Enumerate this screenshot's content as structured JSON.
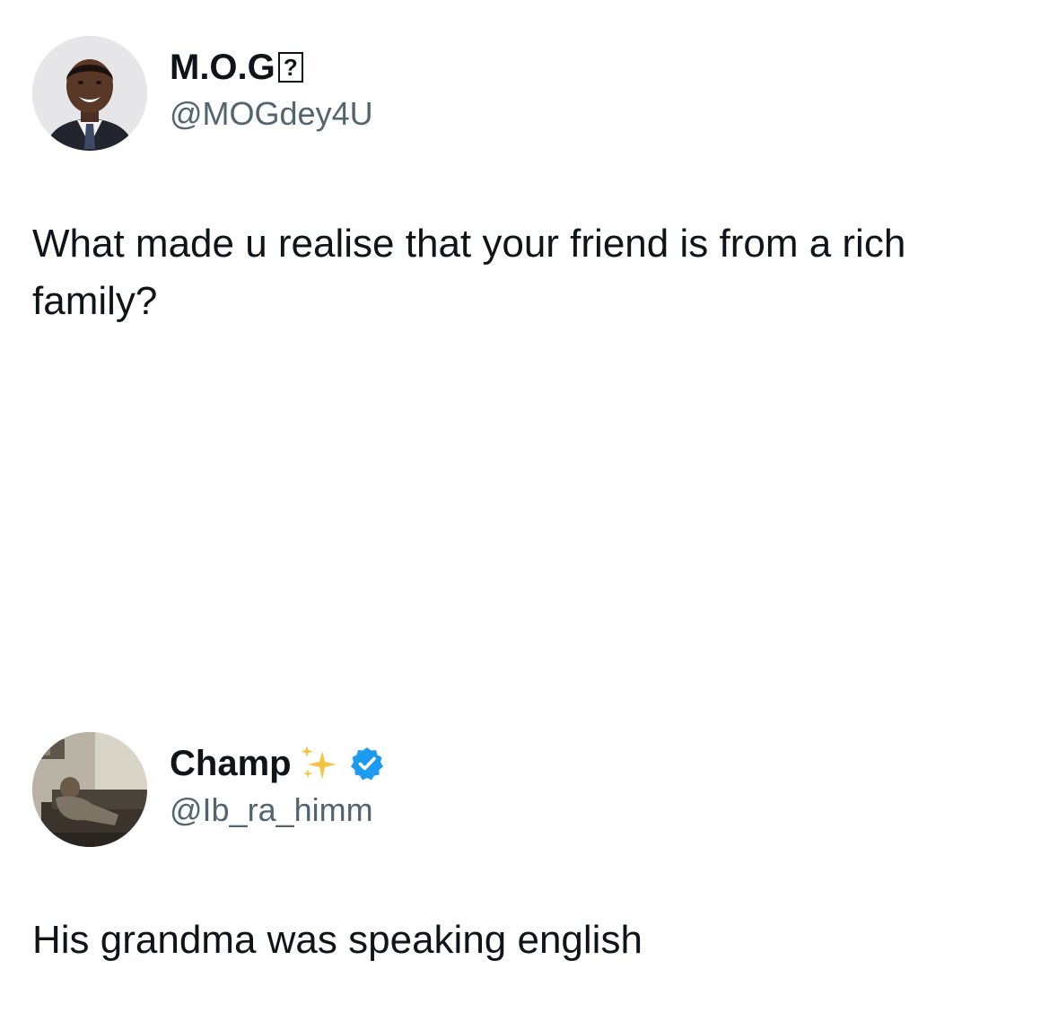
{
  "tweets": [
    {
      "display_name": "M.O.G",
      "name_glyph": "?",
      "handle": "@MOGdey4U",
      "text": "What made u realise that your friend is from a rich family?",
      "avatar_icon": "avatar-man-in-suit"
    },
    {
      "display_name": "Champ",
      "name_emoji": "sparkles-icon",
      "verified": true,
      "handle": "@Ib_ra_himm",
      "text": "His grandma was speaking english",
      "avatar_icon": "avatar-elderly-person-seated"
    }
  ],
  "colors": {
    "text_primary": "#0f1419",
    "text_secondary": "#536471",
    "verified_blue": "#1d9bf0",
    "sparkle_gold": "#f4c542"
  }
}
